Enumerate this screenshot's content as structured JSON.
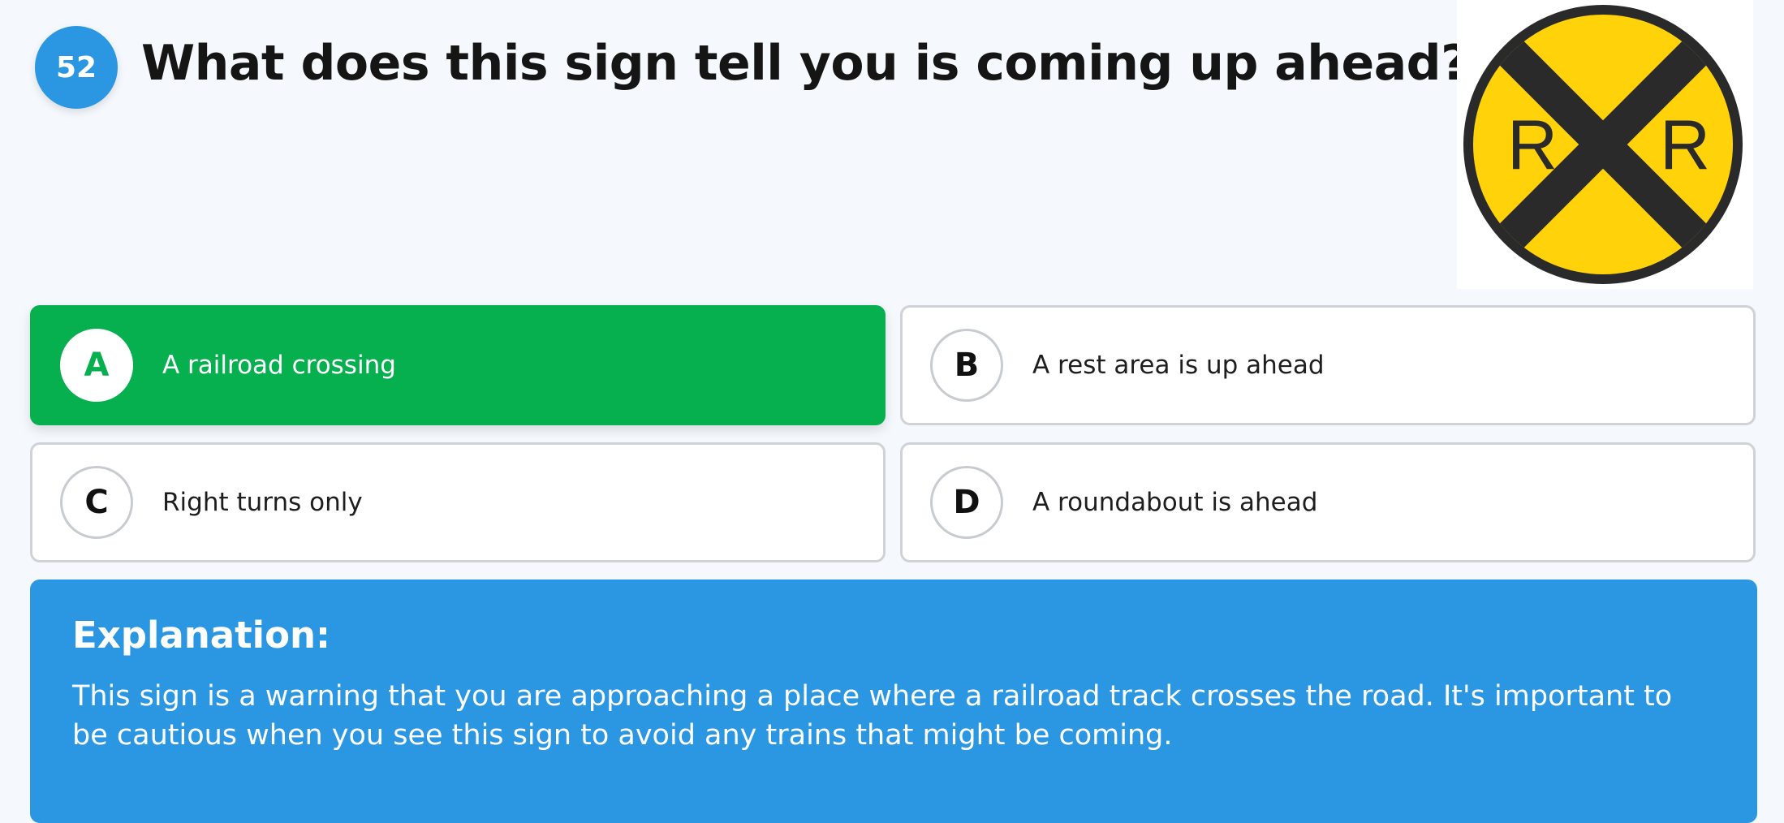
{
  "question": {
    "number": "52",
    "text": "What does this sign tell you is coming up ahead?"
  },
  "sign": {
    "icon": "railroad-crossing-sign-icon",
    "left_letter": "R",
    "right_letter": "R",
    "colors": {
      "fill": "#ffd20a",
      "rim": "#2a2a2a",
      "cross": "#2a2a2a"
    }
  },
  "options": [
    {
      "letter": "A",
      "text": "A railroad crossing",
      "state": "correct"
    },
    {
      "letter": "B",
      "text": "A rest area is up ahead",
      "state": "default"
    },
    {
      "letter": "C",
      "text": "Right turns only",
      "state": "default"
    },
    {
      "letter": "D",
      "text": "A roundabout is ahead",
      "state": "default"
    }
  ],
  "explanation": {
    "title": "Explanation:",
    "body": "This sign is a warning that you are approaching a place where a railroad track crosses the road. It's important to be cautious when you see this sign to avoid any trains that might be coming."
  },
  "colors": {
    "background": "#f5f9fd",
    "accent_blue": "#2b97e3",
    "correct_green": "#07b04f",
    "border_gray": "#cfd3d7"
  }
}
